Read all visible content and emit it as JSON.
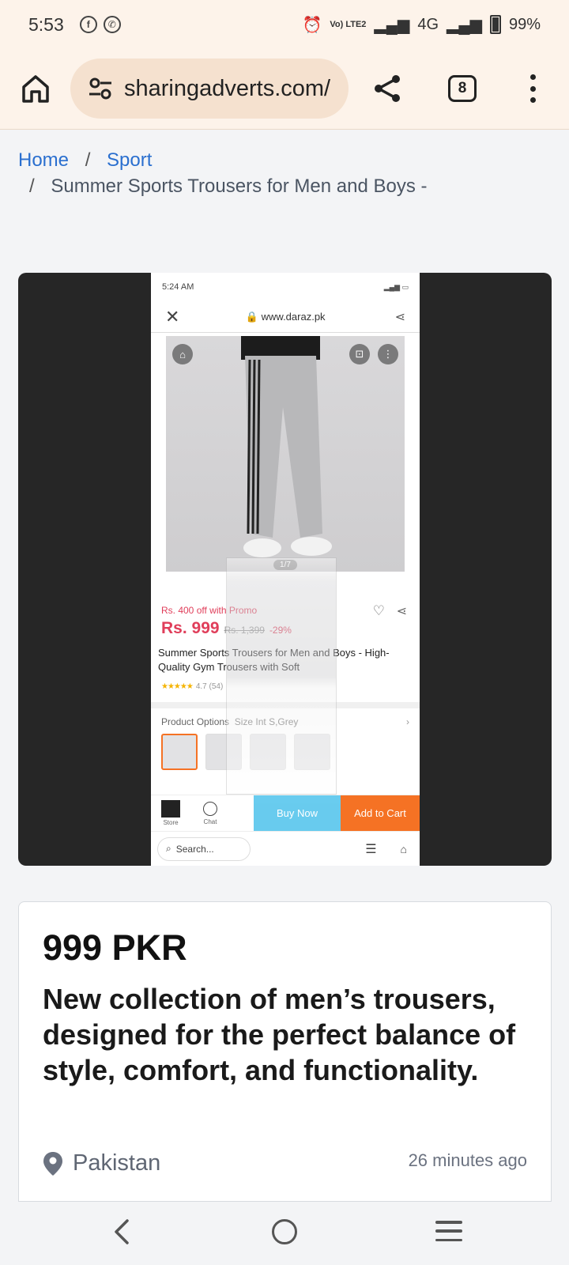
{
  "status_bar": {
    "time": "5:53",
    "network_small": "Vo) LTE2",
    "network": "4G",
    "battery": "99%"
  },
  "browser": {
    "url": "sharingadverts.com/",
    "tab_count": "8"
  },
  "breadcrumb": {
    "home": "Home",
    "separator": "/",
    "category": "Sport",
    "current": "Summer Sports Trousers for Men and Boys -"
  },
  "screenshot": {
    "time": "5:24 AM",
    "url": "www.daraz.pk",
    "image_counter": "1/7",
    "promo": "Rs. 400 off with Promo",
    "price": "Rs. 999",
    "old_price": "Rs. 1,399",
    "discount": "-29%",
    "title": "Summer Sports Trousers for Men and Boys - High-Quality Gym Trousers with Soft",
    "rating": "4.7 (54)",
    "options_label": "Product Options",
    "options_value": "Size Int S,Grey",
    "store_label": "Store",
    "chat_label": "Chat",
    "buy_now": "Buy Now",
    "add_to_cart": "Add to Cart",
    "search_placeholder": "Search..."
  },
  "listing": {
    "price": "999 PKR",
    "description": "New collection of men’s trousers, designed for the perfect balance of style, comfort, and functionality.",
    "location": "Pakistan",
    "posted": "26 minutes ago"
  }
}
